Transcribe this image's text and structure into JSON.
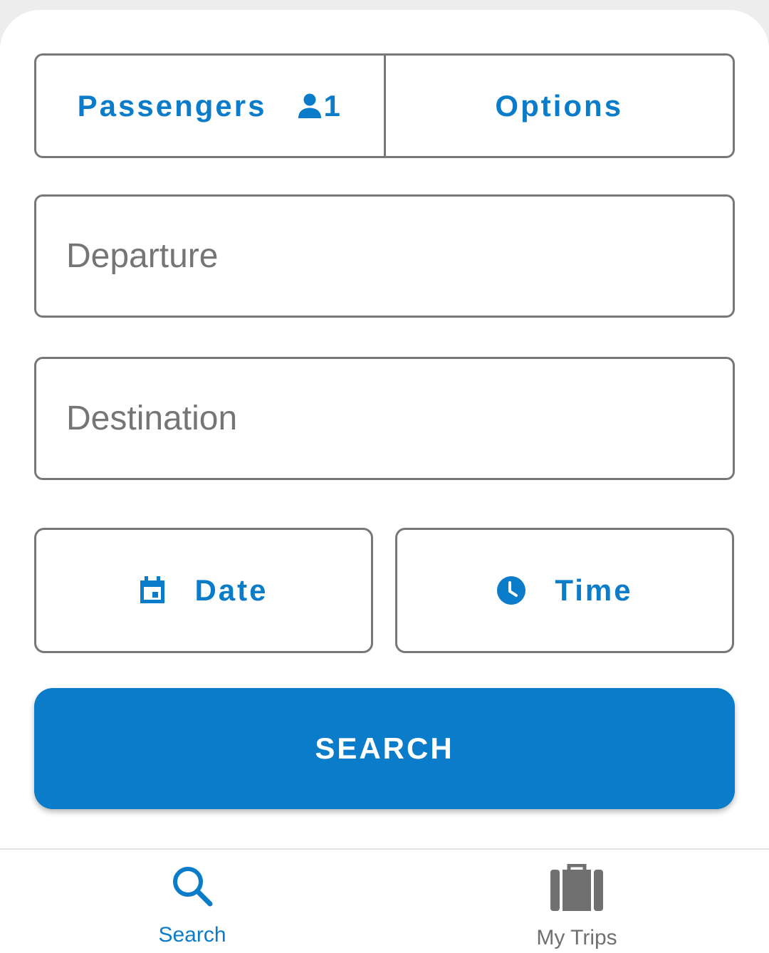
{
  "colors": {
    "accent": "#0a7cc9",
    "border": "#777777",
    "inactive_icon": "#707070",
    "background": "#ffffff"
  },
  "segment": {
    "passengers_label": "Passengers",
    "passengers_icon": "person-icon",
    "passengers_count": "1",
    "options_label": "Options"
  },
  "form": {
    "departure_placeholder": "Departure",
    "departure_value": "",
    "destination_placeholder": "Destination",
    "destination_value": ""
  },
  "pickers": {
    "date_label": "Date",
    "date_icon": "calendar-icon",
    "time_label": "Time",
    "time_icon": "clock-icon"
  },
  "search_button": {
    "label": "SEARCH"
  },
  "bottom_nav": {
    "items": [
      {
        "label": "Search",
        "icon": "search-icon",
        "active": true
      },
      {
        "label": "My Trips",
        "icon": "suitcase-icon",
        "active": false
      }
    ]
  }
}
